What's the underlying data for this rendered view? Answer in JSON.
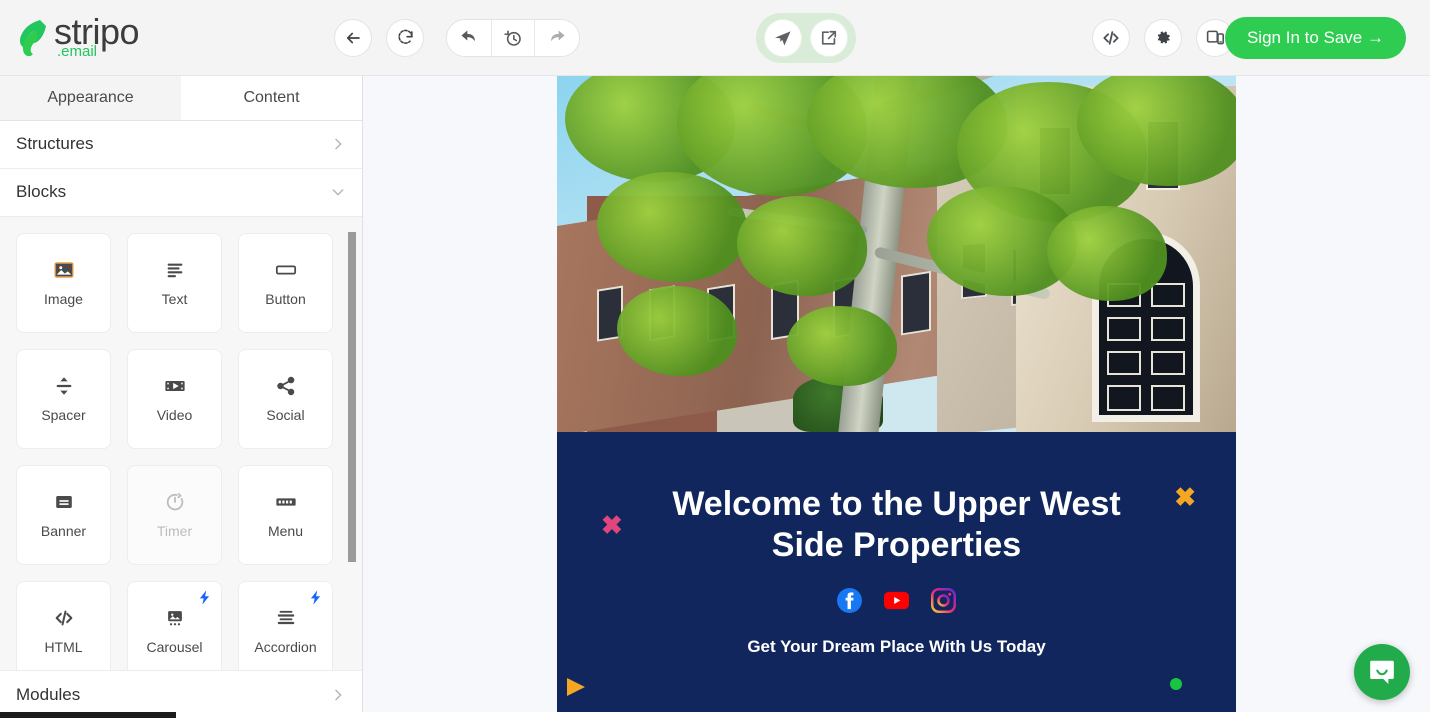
{
  "app": {
    "brand_name": "stripo",
    "brand_suffix": ".email",
    "brand_green": "#22c55e"
  },
  "toolbar": {
    "back_label": "Back",
    "refresh_label": "Reload",
    "undo_label": "Undo",
    "history_label": "History",
    "redo_label": "Redo",
    "send_label": "Send test email",
    "export_label": "Export",
    "code_label": "Code editor",
    "settings_label": "Settings",
    "preview_label": "Preview devices",
    "signin_label": "Sign In to Save →",
    "signin_color": "#2ecc50",
    "send_group_color": "#d8ecd8",
    "icons": {
      "back": "arrow-left-icon",
      "refresh": "refresh-icon",
      "undo": "undo-icon",
      "history": "history-clock-icon",
      "redo": "redo-icon",
      "send": "paper-plane-icon",
      "export": "export-share-icon",
      "code": "code-brackets-icon",
      "settings": "gear-icon",
      "preview": "device-preview-icon"
    }
  },
  "sidebar": {
    "tabs": [
      {
        "label": "Appearance",
        "active": true
      },
      {
        "label": "Content",
        "active": false
      }
    ],
    "sections": [
      {
        "label": "Structures",
        "chevron": "chevron-right-icon",
        "expanded": false
      },
      {
        "label": "Blocks",
        "chevron": "chevron-down-icon",
        "expanded": true
      },
      {
        "label": "Modules",
        "chevron": "chevron-right-icon",
        "expanded": false
      }
    ],
    "blocks": [
      {
        "label": "Image",
        "icon": "image-icon",
        "disabled": false,
        "premium": false
      },
      {
        "label": "Text",
        "icon": "text-lines-icon",
        "disabled": false,
        "premium": false
      },
      {
        "label": "Button",
        "icon": "button-icon",
        "disabled": false,
        "premium": false
      },
      {
        "label": "Spacer",
        "icon": "spacer-icon",
        "disabled": false,
        "premium": false
      },
      {
        "label": "Video",
        "icon": "video-icon",
        "disabled": false,
        "premium": false
      },
      {
        "label": "Social",
        "icon": "share-nodes-icon",
        "disabled": false,
        "premium": false
      },
      {
        "label": "Banner",
        "icon": "banner-icon",
        "disabled": false,
        "premium": false
      },
      {
        "label": "Timer",
        "icon": "timer-icon",
        "disabled": true,
        "premium": false
      },
      {
        "label": "Menu",
        "icon": "menu-icon",
        "disabled": false,
        "premium": false
      },
      {
        "label": "HTML",
        "icon": "code-brackets-icon",
        "disabled": false,
        "premium": false
      },
      {
        "label": "Carousel",
        "icon": "carousel-icon",
        "disabled": false,
        "premium": true
      },
      {
        "label": "Accordion",
        "icon": "accordion-icon",
        "disabled": false,
        "premium": true
      }
    ],
    "premium_badge_icon": "lightning-bolt-icon",
    "premium_badge_color": "#1565ff"
  },
  "email": {
    "hero_image_alt": "Upper West Side brownstone street with tree",
    "cta": {
      "heading": "Welcome to the Upper West Side Properties",
      "subheading": "Get Your Dream Place With Us Today",
      "background_color": "#10265c",
      "social_links": [
        {
          "name": "facebook-icon",
          "color": "#1877f2"
        },
        {
          "name": "youtube-icon",
          "color": "#ff0000"
        },
        {
          "name": "instagram-icon",
          "color": "#e1306c"
        }
      ],
      "decorations": [
        {
          "name": "x-mark-pink",
          "color": "#e0467c",
          "glyph": "✖"
        },
        {
          "name": "x-mark-orange",
          "color": "#f5a623",
          "glyph": "✖"
        },
        {
          "name": "triangle-orange",
          "color": "#f5a623"
        },
        {
          "name": "dot-green",
          "color": "#19c642"
        }
      ]
    }
  },
  "widgets": {
    "chat_label": "Open chat",
    "chat_icon": "chat-bubble-smile-icon",
    "chat_color": "#22ab4b"
  }
}
